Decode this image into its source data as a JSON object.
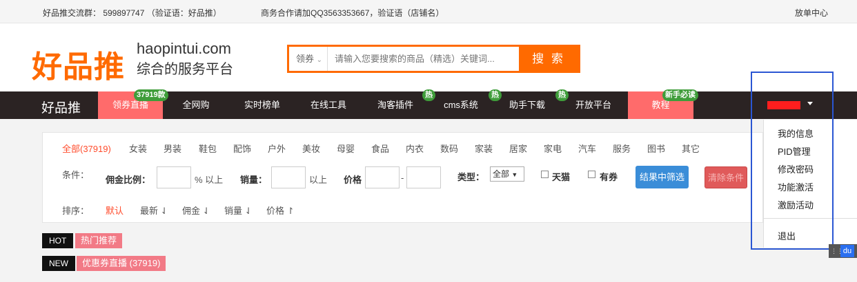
{
  "topbar": {
    "group": "好品推交流群： 599897747 （验证语：好品推）",
    "business": "商务合作请加QQ3563353667，验证语（店铺名）",
    "center": "放单中心"
  },
  "header": {
    "logo_cn": "好品推",
    "logo_en": "haopintui.com",
    "slogan": "综合的服务平台",
    "search_type": "领券",
    "search_placeholder": "请输入您要搜索的商品（精选）关键词...",
    "search_button": "搜 索"
  },
  "nav": {
    "brand": "好品推",
    "items": [
      {
        "label": "领券直播",
        "badge": "37919款"
      },
      {
        "label": "全网购",
        "badge": ""
      },
      {
        "label": "实时榜单",
        "badge": ""
      },
      {
        "label": "在线工具",
        "badge": ""
      },
      {
        "label": "淘客插件",
        "badge": "热"
      },
      {
        "label": "cms系统",
        "badge": "热"
      },
      {
        "label": "助手下载",
        "badge": "热"
      },
      {
        "label": "开放平台",
        "badge": ""
      },
      {
        "label": "教程",
        "badge": "新手必读"
      }
    ]
  },
  "filters": {
    "categories": [
      "全部(37919)",
      "女装",
      "男装",
      "鞋包",
      "配饰",
      "户外",
      "美妆",
      "母婴",
      "食品",
      "内衣",
      "数码",
      "家装",
      "居家",
      "家电",
      "汽车",
      "服务",
      "图书",
      "其它"
    ],
    "conditions_label": "条件：",
    "commission_label": "佣金比例：",
    "commission_unit": "% 以上",
    "sales_label": "销量：",
    "sales_unit": "以上",
    "price_label": "价格",
    "price_dash": "-",
    "type_label": "类型：",
    "type_value": "全部",
    "tmall_label": "天猫",
    "coupon_label": "有券",
    "filter_button": "结果中筛选",
    "clear_button": "清除条件",
    "sort_label": "排序：",
    "sort_items": [
      "默认",
      "最新 ⇃",
      "佣金 ⇃",
      "销量 ⇃",
      "价格 ↾"
    ]
  },
  "tags": {
    "hot": "HOT",
    "hot_label": "热门推荐",
    "new": "NEW",
    "new_label": "优惠券直播 (37919)"
  },
  "user_menu": {
    "items": [
      "我的信息",
      "PID管理",
      "修改密码",
      "功能激活",
      "激励活动"
    ],
    "logout": "退出"
  },
  "widget": {
    "du": "du"
  },
  "colors": {
    "accent": "#ff6a00",
    "nav_bg": "#2b2323",
    "nav_pink": "#ff6b6b",
    "badge_green": "#3f9d3a",
    "active_red": "#ff4b2b",
    "annotation_blue": "#2a56d3"
  }
}
